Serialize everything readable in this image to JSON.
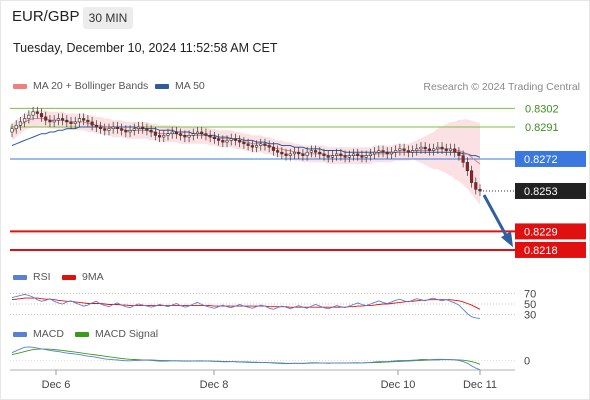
{
  "header": {
    "symbol": "EUR/GBP",
    "timeframe": "30 MIN",
    "datetime": "Tuesday, December 10, 2024 11:52:58 AM CET"
  },
  "legend_main": [
    {
      "label": "MA 20 + Bollinger Bands",
      "color": "#f08080"
    },
    {
      "label": "MA 50",
      "color": "#2e5c9e"
    }
  ],
  "credit": "Research © 2024 Trading Central",
  "legend_rsi": [
    {
      "label": "RSI",
      "color": "#5b7fd6"
    },
    {
      "label": "9MA",
      "color": "#e01010"
    }
  ],
  "legend_macd": [
    {
      "label": "MACD",
      "color": "#5b7fd6"
    },
    {
      "label": "MACD Signal",
      "color": "#3a9a1a"
    }
  ],
  "colors": {
    "resistance": "#7fbf3f",
    "pivot": "#3a78e0",
    "support": "#e01010",
    "last_price": "#222222",
    "arrow": "#2f5f9f",
    "candle_up": "#ffffff",
    "candle_down": "#b01818"
  },
  "chart_data": {
    "type": "candlestick",
    "y_range": [
      0.8215,
      0.8307
    ],
    "x_ticks": [
      "Dec 6",
      "Dec 8",
      "Dec 10",
      "Dec 11"
    ],
    "levels": [
      {
        "value": 0.8302,
        "label": "0.8302",
        "kind": "resistance"
      },
      {
        "value": 0.8291,
        "label": "0.8291",
        "kind": "resistance"
      },
      {
        "value": 0.8272,
        "label": "0.8272",
        "kind": "pivot"
      },
      {
        "value": 0.8253,
        "label": "0.8253",
        "kind": "last"
      },
      {
        "value": 0.8229,
        "label": "0.8229",
        "kind": "support"
      },
      {
        "value": 0.8218,
        "label": "0.8218",
        "kind": "support"
      }
    ],
    "close": [
      0.829,
      0.8292,
      0.8294,
      0.8296,
      0.8298,
      0.83,
      0.8299,
      0.8297,
      0.8295,
      0.8294,
      0.8295,
      0.8296,
      0.8295,
      0.8294,
      0.8293,
      0.8294,
      0.8296,
      0.8295,
      0.8294,
      0.8292,
      0.8291,
      0.829,
      0.8289,
      0.829,
      0.8291,
      0.829,
      0.8289,
      0.8288,
      0.8289,
      0.829,
      0.8291,
      0.829,
      0.8289,
      0.8288,
      0.8286,
      0.8285,
      0.8286,
      0.8287,
      0.8288,
      0.8287,
      0.8286,
      0.8285,
      0.8286,
      0.8287,
      0.8288,
      0.8287,
      0.8286,
      0.8285,
      0.8284,
      0.8283,
      0.8282,
      0.8283,
      0.8284,
      0.8283,
      0.8282,
      0.8281,
      0.828,
      0.8279,
      0.828,
      0.8281,
      0.828,
      0.8279,
      0.8277,
      0.8276,
      0.8275,
      0.8274,
      0.8275,
      0.8276,
      0.8275,
      0.8274,
      0.8276,
      0.8277,
      0.8276,
      0.8275,
      0.8274,
      0.8273,
      0.8274,
      0.8275,
      0.8274,
      0.8273,
      0.8274,
      0.8275,
      0.8274,
      0.8273,
      0.8274,
      0.8275,
      0.8276,
      0.8277,
      0.8276,
      0.8275,
      0.8276,
      0.8277,
      0.8278,
      0.8277,
      0.8276,
      0.8277,
      0.8278,
      0.8279,
      0.8278,
      0.8277,
      0.8278,
      0.8279,
      0.8278,
      0.8277,
      0.8278,
      0.8276,
      0.8274,
      0.827,
      0.8265,
      0.8258,
      0.8254,
      0.8253
    ],
    "ma20": [
      0.8288,
      0.829,
      0.8292,
      0.8294,
      0.8295,
      0.8296,
      0.8296,
      0.8296,
      0.8296,
      0.8295,
      0.8295,
      0.8295,
      0.8295,
      0.8294,
      0.8294,
      0.8294,
      0.8294,
      0.8294,
      0.8293,
      0.8293,
      0.8292,
      0.8292,
      0.8291,
      0.8291,
      0.829,
      0.829,
      0.829,
      0.8289,
      0.8289,
      0.8289,
      0.8289,
      0.8289,
      0.8289,
      0.8288,
      0.8288,
      0.8287,
      0.8287,
      0.8287,
      0.8287,
      0.8287,
      0.8286,
      0.8286,
      0.8286,
      0.8286,
      0.8286,
      0.8286,
      0.8286,
      0.8285,
      0.8285,
      0.8284,
      0.8284,
      0.8284,
      0.8284,
      0.8283,
      0.8283,
      0.8282,
      0.8282,
      0.8281,
      0.8281,
      0.8281,
      0.828,
      0.828,
      0.8279,
      0.8278,
      0.8278,
      0.8277,
      0.8277,
      0.8276,
      0.8276,
      0.8275,
      0.8275,
      0.8275,
      0.8275,
      0.8275,
      0.8275,
      0.8274,
      0.8274,
      0.8274,
      0.8274,
      0.8274,
      0.8274,
      0.8274,
      0.8274,
      0.8274,
      0.8274,
      0.8274,
      0.8275,
      0.8275,
      0.8275,
      0.8275,
      0.8275,
      0.8276,
      0.8276,
      0.8276,
      0.8276,
      0.8277,
      0.8277,
      0.8277,
      0.8277,
      0.8277,
      0.8277,
      0.8278,
      0.8278,
      0.8278,
      0.8278,
      0.8277,
      0.8277,
      0.8276,
      0.8275,
      0.8273,
      0.8271,
      0.8269
    ],
    "ma50": [
      0.828,
      0.8281,
      0.8282,
      0.8283,
      0.8284,
      0.8285,
      0.8286,
      0.8287,
      0.8287,
      0.8288,
      0.8288,
      0.8289,
      0.8289,
      0.829,
      0.829,
      0.829,
      0.8291,
      0.8291,
      0.8291,
      0.8291,
      0.8291,
      0.8291,
      0.8291,
      0.8291,
      0.8291,
      0.8291,
      0.8291,
      0.8291,
      0.8291,
      0.8291,
      0.829,
      0.829,
      0.829,
      0.829,
      0.829,
      0.8289,
      0.8289,
      0.8289,
      0.8289,
      0.8288,
      0.8288,
      0.8288,
      0.8288,
      0.8287,
      0.8287,
      0.8287,
      0.8286,
      0.8286,
      0.8286,
      0.8285,
      0.8285,
      0.8285,
      0.8284,
      0.8284,
      0.8284,
      0.8283,
      0.8283,
      0.8283,
      0.8282,
      0.8282,
      0.8282,
      0.8281,
      0.8281,
      0.8281,
      0.828,
      0.828,
      0.828,
      0.8279,
      0.8279,
      0.8279,
      0.8278,
      0.8278,
      0.8278,
      0.8278,
      0.8277,
      0.8277,
      0.8277,
      0.8277,
      0.8277,
      0.8276,
      0.8276,
      0.8276,
      0.8276,
      0.8276,
      0.8276,
      0.8276,
      0.8276,
      0.8276,
      0.8276,
      0.8276,
      0.8276,
      0.8276,
      0.8276,
      0.8276,
      0.8276,
      0.8276,
      0.8276,
      0.8276,
      0.8276,
      0.8276,
      0.8276,
      0.8276,
      0.8276,
      0.8276,
      0.8276,
      0.8276,
      0.8276,
      0.8275,
      0.8275,
      0.8274,
      0.8274,
      0.8273
    ],
    "rsi": {
      "levels": [
        {
          "value": 70,
          "label": "70"
        },
        {
          "value": 50,
          "label": "50"
        },
        {
          "value": 30,
          "label": "30"
        }
      ],
      "rsi": [
        62,
        64,
        66,
        68,
        66,
        63,
        58,
        55,
        57,
        60,
        55,
        52,
        50,
        54,
        56,
        52,
        49,
        46,
        48,
        52,
        55,
        50,
        47,
        45,
        49,
        52,
        48,
        45,
        43,
        47,
        50,
        48,
        46,
        44,
        46,
        49,
        47,
        45,
        48,
        51,
        47,
        44,
        46,
        50,
        53,
        49,
        46,
        44,
        42,
        45,
        48,
        45,
        43,
        46,
        49,
        46,
        44,
        42,
        45,
        48,
        46,
        42,
        40,
        43,
        46,
        44,
        41,
        44,
        47,
        44,
        42,
        46,
        49,
        46,
        43,
        41,
        44,
        47,
        45,
        43,
        46,
        49,
        52,
        49,
        47,
        50,
        53,
        56,
        53,
        51,
        54,
        57,
        59,
        56,
        54,
        57,
        60,
        58,
        56,
        59,
        61,
        58,
        56,
        58,
        55,
        52,
        48,
        40,
        32,
        26,
        24,
        23
      ],
      "ma9": [
        58,
        59,
        60,
        61,
        61,
        61,
        61,
        60,
        59,
        59,
        58,
        57,
        56,
        55,
        55,
        54,
        53,
        52,
        51,
        51,
        51,
        51,
        50,
        49,
        49,
        49,
        48,
        48,
        47,
        47,
        47,
        47,
        47,
        47,
        47,
        47,
        47,
        47,
        47,
        47,
        47,
        47,
        47,
        47,
        47,
        47,
        47,
        47,
        46,
        46,
        46,
        46,
        46,
        46,
        46,
        46,
        46,
        46,
        46,
        46,
        46,
        45,
        45,
        45,
        45,
        45,
        44,
        44,
        44,
        44,
        44,
        44,
        44,
        44,
        44,
        44,
        44,
        44,
        44,
        44,
        45,
        45,
        46,
        46,
        47,
        47,
        48,
        49,
        50,
        50,
        51,
        52,
        53,
        54,
        55,
        55,
        56,
        57,
        57,
        58,
        58,
        58,
        58,
        58,
        58,
        57,
        56,
        54,
        51,
        48,
        44,
        40
      ]
    },
    "macd": {
      "zero_label": "0",
      "macd": [
        4.0,
        5.0,
        6.0,
        6.8,
        7.0,
        6.8,
        6.4,
        6.0,
        5.6,
        5.2,
        4.9,
        4.6,
        4.2,
        3.8,
        3.6,
        3.3,
        3.0,
        2.6,
        2.2,
        2.0,
        1.6,
        1.2,
        0.8,
        0.6,
        0.4,
        0.2,
        0.0,
        -0.2,
        -0.2,
        -0.1,
        0.0,
        0.1,
        0.1,
        0.0,
        -0.2,
        -0.4,
        -0.4,
        -0.3,
        -0.2,
        -0.2,
        -0.3,
        -0.4,
        -0.4,
        -0.3,
        -0.2,
        -0.2,
        -0.3,
        -0.4,
        -0.5,
        -0.6,
        -0.7,
        -0.7,
        -0.6,
        -0.7,
        -0.8,
        -0.9,
        -1.0,
        -1.1,
        -1.1,
        -1.0,
        -1.1,
        -1.2,
        -1.4,
        -1.5,
        -1.6,
        -1.7,
        -1.6,
        -1.5,
        -1.5,
        -1.6,
        -1.4,
        -1.2,
        -1.2,
        -1.3,
        -1.4,
        -1.5,
        -1.4,
        -1.3,
        -1.3,
        -1.4,
        -1.3,
        -1.2,
        -1.2,
        -1.3,
        -1.2,
        -1.0,
        -0.8,
        -0.6,
        -0.6,
        -0.6,
        -0.4,
        -0.2,
        0.0,
        0.0,
        0.0,
        0.1,
        0.3,
        0.5,
        0.5,
        0.4,
        0.5,
        0.6,
        0.6,
        0.5,
        0.5,
        0.3,
        0.0,
        -0.6,
        -1.5,
        -2.8,
        -4.0,
        -4.8
      ],
      "signal": [
        3.0,
        3.5,
        4.0,
        4.6,
        5.2,
        5.6,
        5.8,
        5.9,
        5.9,
        5.8,
        5.6,
        5.4,
        5.2,
        4.9,
        4.6,
        4.3,
        4.0,
        3.7,
        3.4,
        3.1,
        2.8,
        2.5,
        2.2,
        1.9,
        1.6,
        1.3,
        1.0,
        0.8,
        0.6,
        0.5,
        0.4,
        0.3,
        0.3,
        0.2,
        0.1,
        0.0,
        -0.1,
        -0.1,
        -0.2,
        -0.2,
        -0.2,
        -0.3,
        -0.3,
        -0.3,
        -0.3,
        -0.3,
        -0.3,
        -0.3,
        -0.4,
        -0.4,
        -0.5,
        -0.5,
        -0.6,
        -0.6,
        -0.7,
        -0.7,
        -0.8,
        -0.9,
        -0.9,
        -1.0,
        -1.0,
        -1.1,
        -1.2,
        -1.3,
        -1.4,
        -1.5,
        -1.5,
        -1.5,
        -1.5,
        -1.5,
        -1.5,
        -1.4,
        -1.4,
        -1.4,
        -1.4,
        -1.4,
        -1.4,
        -1.4,
        -1.4,
        -1.4,
        -1.3,
        -1.3,
        -1.3,
        -1.3,
        -1.2,
        -1.2,
        -1.1,
        -1.0,
        -0.9,
        -0.8,
        -0.7,
        -0.6,
        -0.5,
        -0.4,
        -0.3,
        -0.2,
        -0.1,
        0.0,
        0.1,
        0.2,
        0.3,
        0.3,
        0.4,
        0.4,
        0.4,
        0.4,
        0.3,
        0.1,
        -0.2,
        -0.6,
        -1.2,
        -2.0
      ]
    }
  }
}
